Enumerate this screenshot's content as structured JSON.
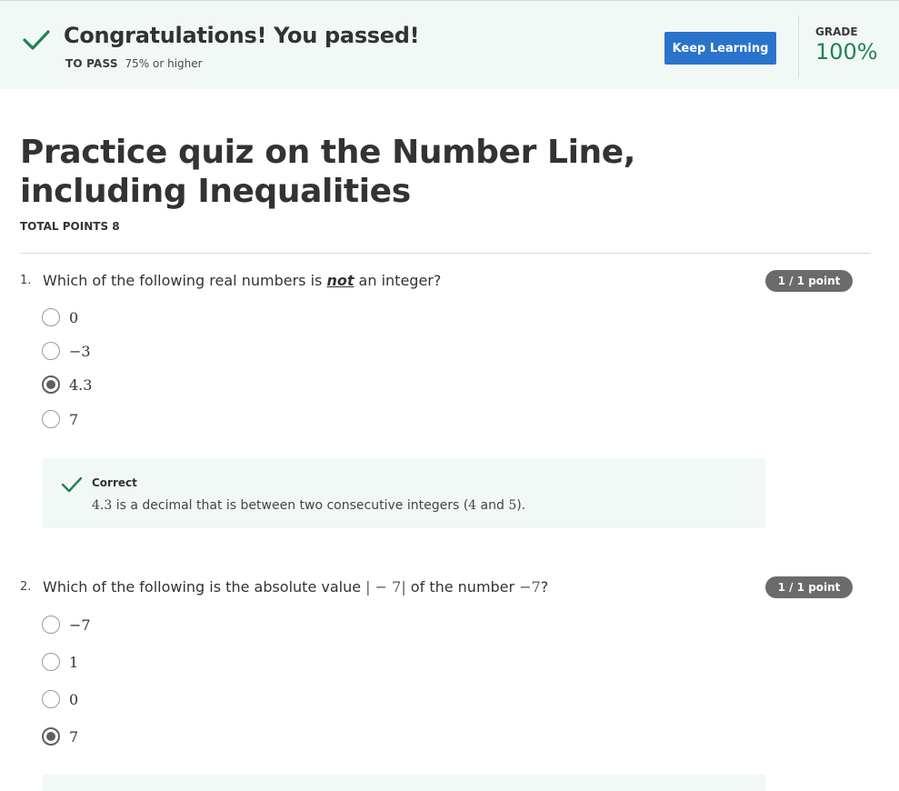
{
  "banner": {
    "title": "Congratulations! You passed!",
    "to_pass_label": "TO PASS",
    "to_pass_value": "75% or higher",
    "keep_learning": "Keep Learning",
    "grade_label": "GRADE",
    "grade_value": "100%"
  },
  "quiz": {
    "title": "Practice quiz on the Number Line, including Inequalities",
    "total_points": "TOTAL POINTS 8"
  },
  "questions": [
    {
      "number": "1.",
      "text_before": "Which of the following real numbers is ",
      "text_emphasis": "not",
      "text_after": " an integer?",
      "points": "1 / 1 point",
      "options": [
        "0",
        "−3",
        "4.3",
        "7"
      ],
      "selected_index": 2,
      "feedback": {
        "head": "Correct",
        "value": "4.3",
        "text_1": " is a decimal that is between two consecutive integers (",
        "a": "4",
        "and": " and ",
        "b": "5",
        "end": ")."
      }
    },
    {
      "number": "2.",
      "text_before": "Which of the following is the absolute value ",
      "math_abs": "| − 7|",
      "text_mid": " of the number ",
      "math_num": "−7",
      "text_after": "?",
      "points": "1 / 1 point",
      "options": [
        "−7",
        "1",
        "0",
        "7"
      ],
      "selected_index": 3
    }
  ],
  "colors": {
    "banner_bg": "#f2f8f6",
    "accent_blue": "#2a73cc",
    "success_green": "#1f8354",
    "badge_gray": "#6b6b6b"
  },
  "icons": {
    "banner_check": "check-icon",
    "feedback_check": "check-icon"
  }
}
